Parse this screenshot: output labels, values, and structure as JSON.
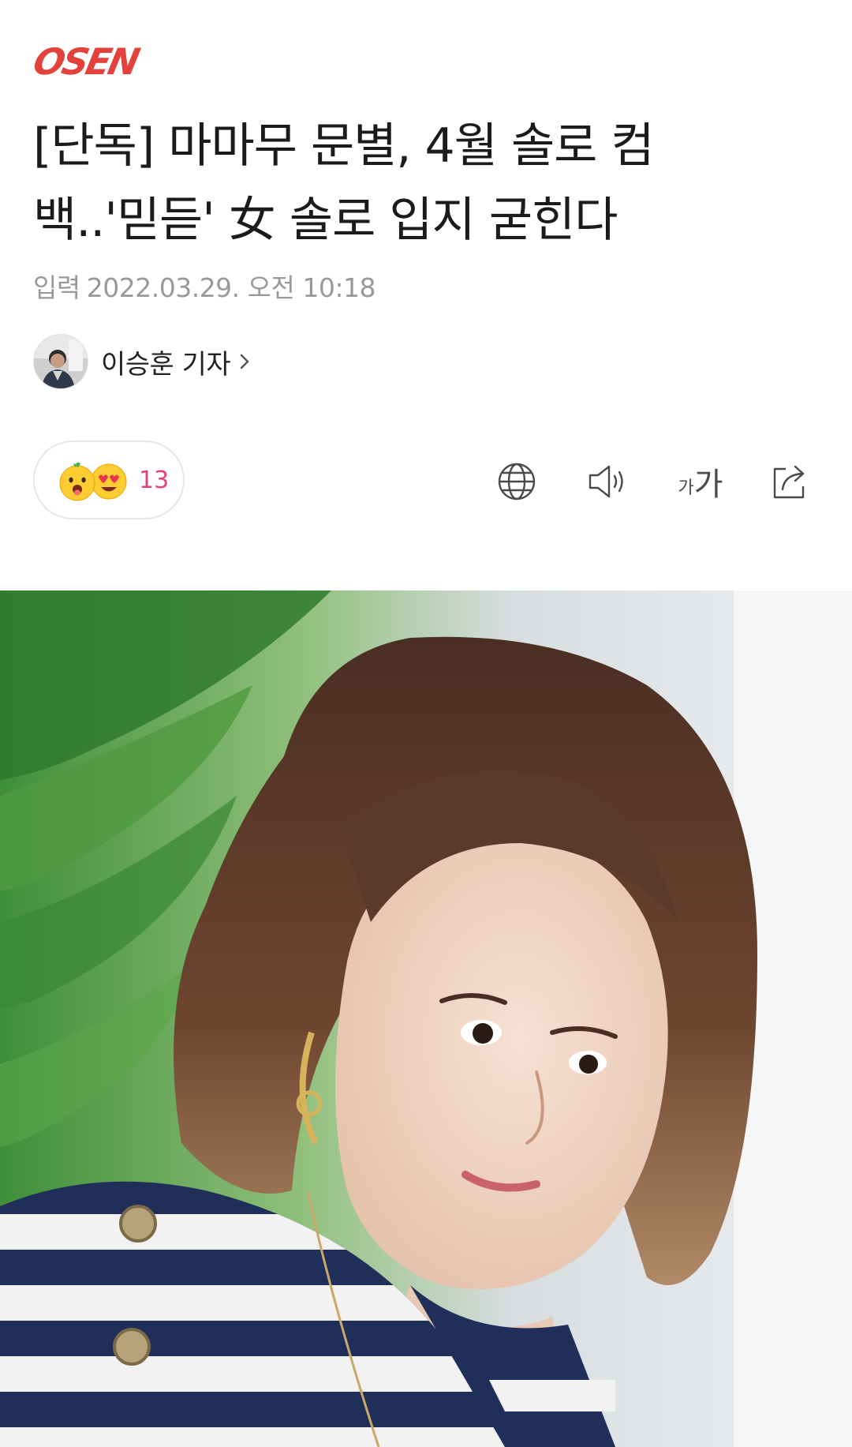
{
  "logo": {
    "text": "OSEN",
    "color": "#e2413c"
  },
  "article": {
    "headline_line1": "[단독] 마마무 문별, 4월 솔로 컴",
    "headline_line2": "백..'믿듣' 女 솔로 입지 굳힌다",
    "date_label": "입력",
    "date_value": "2022.03.29. 오전 10:18"
  },
  "reporter": {
    "name": "이승훈 기자"
  },
  "reactions": {
    "count": "13",
    "count_color": "#e0427a",
    "emojis": [
      "tongue-out-emoji",
      "heart-eyes-emoji"
    ]
  },
  "toolbar": {
    "icons": [
      "globe-icon",
      "speaker-icon",
      "font-size-icon",
      "share-icon"
    ],
    "font_small": "가",
    "font_large": "가"
  },
  "photo": {
    "subject": "woman-portrait"
  }
}
